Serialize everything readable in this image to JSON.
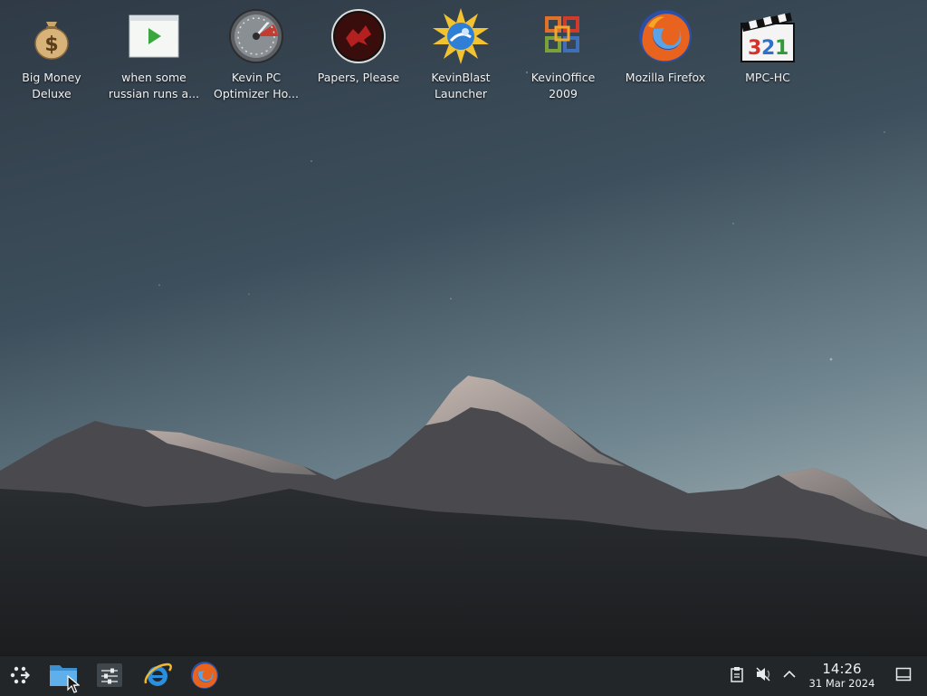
{
  "desktop": {
    "icons": [
      {
        "id": "big-money-deluxe",
        "label": "Big Money\nDeluxe",
        "icon": "money-bag-icon"
      },
      {
        "id": "russian-video",
        "label": "when some\nrussian runs a...",
        "icon": "video-file-icon"
      },
      {
        "id": "kevin-pc-optimizer",
        "label": "Kevin PC\nOptimizer Ho...",
        "icon": "speedometer-icon"
      },
      {
        "id": "papers-please",
        "label": "Papers, Please",
        "icon": "papers-please-icon"
      },
      {
        "id": "kevinblast-launcher",
        "label": "KevinBlast\nLauncher",
        "icon": "blast-launcher-icon"
      },
      {
        "id": "kevinoffice-2009",
        "label": "KevinOffice\n2009",
        "icon": "office-icon"
      },
      {
        "id": "mozilla-firefox",
        "label": "Mozilla Firefox",
        "icon": "firefox-icon"
      },
      {
        "id": "mpc-hc",
        "label": "MPC-HC",
        "icon": "clapperboard-icon"
      }
    ]
  },
  "taskbar": {
    "launcher_icon": "app-launcher-icon",
    "pinned": [
      {
        "name": "file-manager",
        "icon": "folder-icon"
      },
      {
        "name": "system-settings",
        "icon": "settings-sliders-icon"
      },
      {
        "name": "internet-explorer",
        "icon": "internet-explorer-icon"
      },
      {
        "name": "firefox",
        "icon": "firefox-icon"
      }
    ],
    "tray": {
      "clipboard_icon": "clipboard-icon",
      "volume_icon": "volume-muted-icon",
      "expand_icon": "chevron-up-icon",
      "show_desktop_icon": "show-desktop-icon"
    },
    "clock": {
      "time": "14:26",
      "date": "31 Mar 2024"
    }
  },
  "colors": {
    "taskbar_bg": "#222629",
    "sky_top": "#2f3a46",
    "sky_bottom": "#90a3ad",
    "label_text": "#f2f2f2"
  }
}
